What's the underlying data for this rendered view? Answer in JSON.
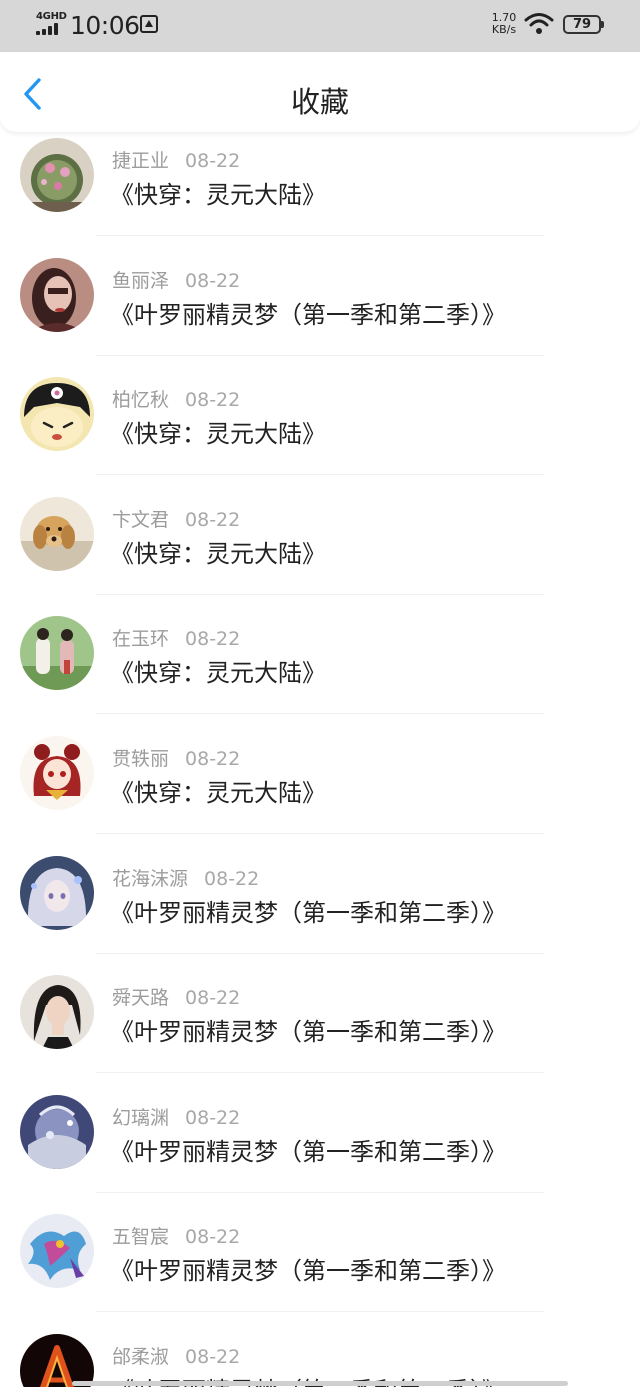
{
  "status_bar": {
    "network": "4GHD",
    "time": "10:06",
    "speed_value": "1.70",
    "speed_unit": "KB/s",
    "battery": "79"
  },
  "header": {
    "title": "收藏",
    "accent_color": "#2196f3"
  },
  "favorites": [
    {
      "name": "捷正业",
      "date": "08-22",
      "book": "《快穿：灵元大陆》",
      "avatar": "cactus-flowers"
    },
    {
      "name": "鱼丽泽",
      "date": "08-22",
      "book": "《叶罗丽精灵梦（第一季和第二季）》",
      "avatar": "girl-portrait"
    },
    {
      "name": "柏忆秋",
      "date": "08-22",
      "book": "《快穿：灵元大陆》",
      "avatar": "kuromi-cartoon"
    },
    {
      "name": "卞文君",
      "date": "08-22",
      "book": "《快穿：灵元大陆》",
      "avatar": "golden-dog"
    },
    {
      "name": "在玉环",
      "date": "08-22",
      "book": "《快穿：灵元大陆》",
      "avatar": "couple-outdoor"
    },
    {
      "name": "贯轶丽",
      "date": "08-22",
      "book": "《快穿：灵元大陆》",
      "avatar": "red-anime-girl"
    },
    {
      "name": "花海沫源",
      "date": "08-22",
      "book": "《叶罗丽精灵梦（第一季和第二季）》",
      "avatar": "silver-anime-girl"
    },
    {
      "name": "舜天路",
      "date": "08-22",
      "book": "《叶罗丽精灵梦（第一季和第二季）》",
      "avatar": "woman-portrait"
    },
    {
      "name": "幻璃渊",
      "date": "08-22",
      "book": "《叶罗丽精灵梦（第一季和第二季）》",
      "avatar": "dark-fantasy"
    },
    {
      "name": "五智宸",
      "date": "08-22",
      "book": "《叶罗丽精灵梦（第一季和第二季）》",
      "avatar": "colorful-dragon"
    },
    {
      "name": "邰柔淑",
      "date": "08-22",
      "book": "《叶罗丽精灵梦（第一季和第二季）》",
      "avatar": "fire-letter-a"
    }
  ]
}
